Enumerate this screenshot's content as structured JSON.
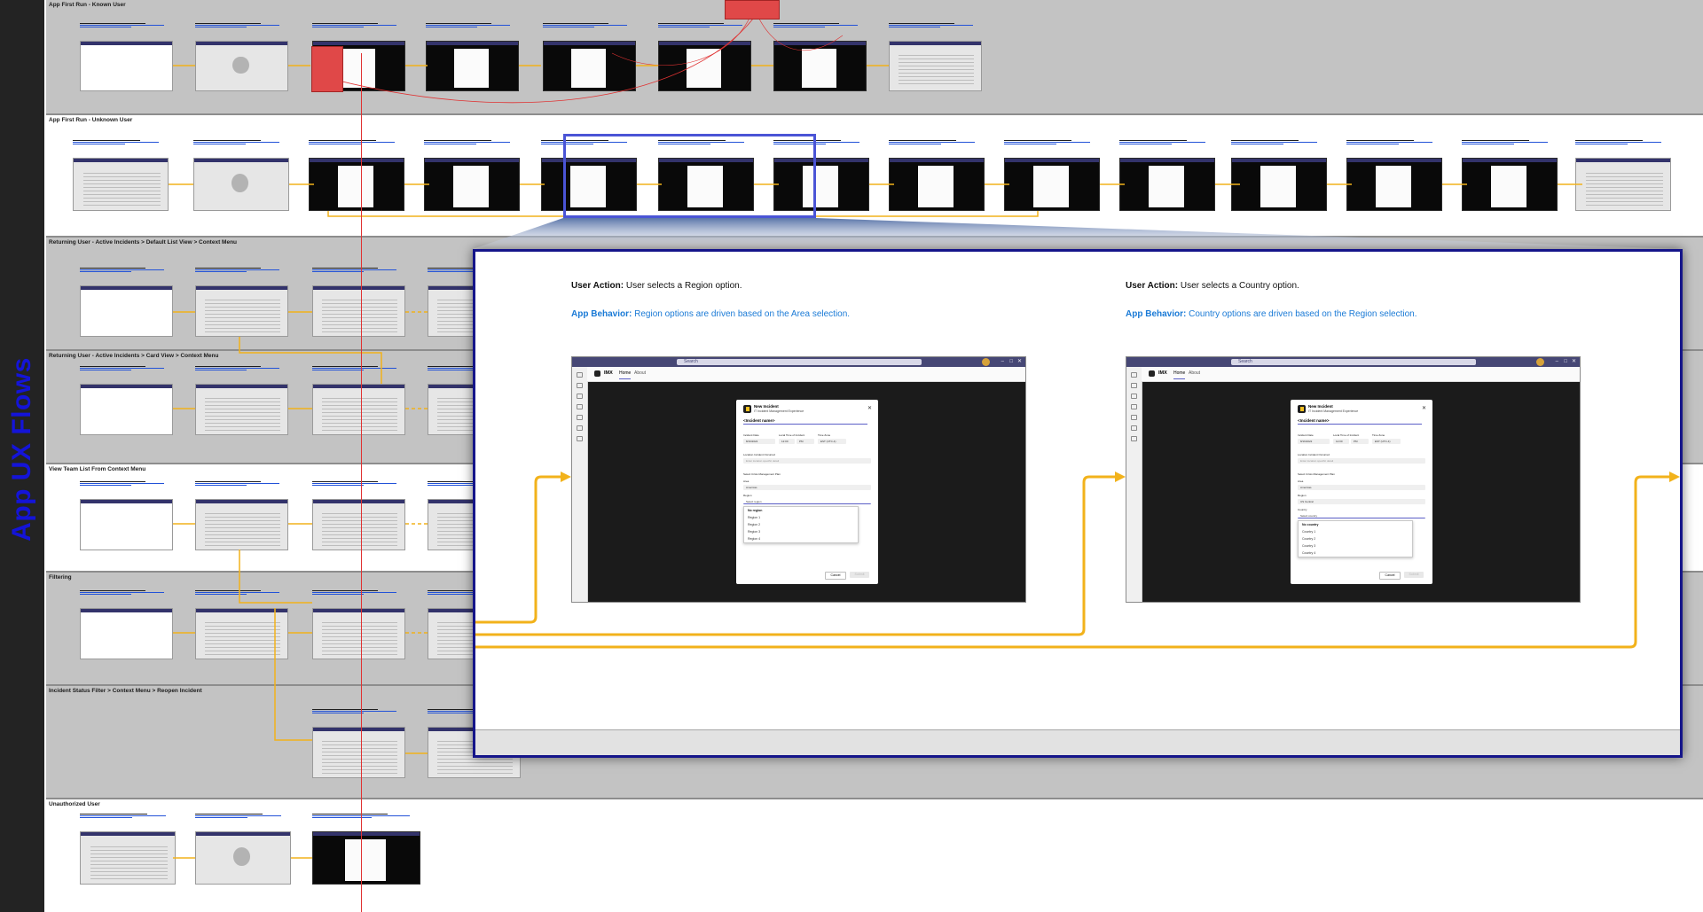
{
  "board": {
    "vertical_title": "App UX Flows",
    "lanes": [
      "App First Run - Known User",
      "App First Run - Unknown User",
      "Returning User - Active Incidents > Default List View > Context Menu",
      "Returning User - Active Incidents > Card View > Context Menu",
      "View Team List From Context Menu",
      "Filtering",
      "Incident Status Filter > Context Menu > Reopen Incident",
      "Unauthorized User"
    ]
  },
  "popup": {
    "step1": {
      "ua_label": "User Action:",
      "ua_text": "User selects a Region option.",
      "ab_label": "App Behavior:",
      "ab_text": "Region options are driven based on the Area selection.",
      "app": {
        "search": "Search",
        "app_name": "IMX",
        "tab_home": "Home",
        "tab_about": "About",
        "dialog_title": "New Incident",
        "dialog_subtitle": "IT Incident Management Experience",
        "incident_name": "<Incident name>",
        "label_date": "Incident Date",
        "label_time": "Local Time of Incident",
        "label_zone": "Time Zone",
        "value_date": "8/16/2022",
        "value_time": "12:00",
        "value_ampm": "PM",
        "value_zone": "EST (UTC-4)",
        "label_location": "Location Incident Occurred",
        "placeholder_location": "Enter location specific detail",
        "label_plan": "Select Crisis Management Plan",
        "label_area": "Area",
        "value_area": "Americas",
        "label_region": "Region",
        "value_region": "Select region",
        "options": [
          "No region",
          "Region 1",
          "Region 2",
          "Region 3",
          "Region 4"
        ],
        "cancel": "Cancel",
        "submit": "Submit"
      }
    },
    "step2": {
      "ua_label": "User Action:",
      "ua_text": "User selects a Country option.",
      "ab_label": "App Behavior:",
      "ab_text": "Country options are driven based on the Region selection.",
      "app": {
        "search": "Search",
        "app_name": "IMX",
        "tab_home": "Home",
        "tab_about": "About",
        "dialog_title": "New Incident",
        "dialog_subtitle": "IT Incident Management Experience",
        "incident_name": "<Incident name>",
        "label_date": "Incident Date",
        "label_time": "Local Time of Incident",
        "label_zone": "Time Zone",
        "value_date": "8/16/2022",
        "value_time": "12:00",
        "value_ampm": "PM",
        "value_zone": "EST (UTC-4)",
        "label_location": "Location Incident Occurred",
        "placeholder_location": "Enter location specific detail",
        "label_plan": "Select Crisis Management Plan",
        "label_area": "Area",
        "value_area": "Americas",
        "label_region": "Region",
        "value_region": "US Central",
        "label_country": "Country",
        "value_country": "Select country",
        "options": [
          "No country",
          "Country 1",
          "Country 2",
          "Country 3",
          "Country 4"
        ],
        "cancel": "Cancel",
        "submit": "Submit"
      }
    }
  },
  "colors": {
    "flow_arrow": "#f2b21b",
    "title_blue": "#1414d8",
    "behavior_blue": "#1a7ad6",
    "lane_grey": "#c3c3c3",
    "note_red": "#e04848"
  }
}
